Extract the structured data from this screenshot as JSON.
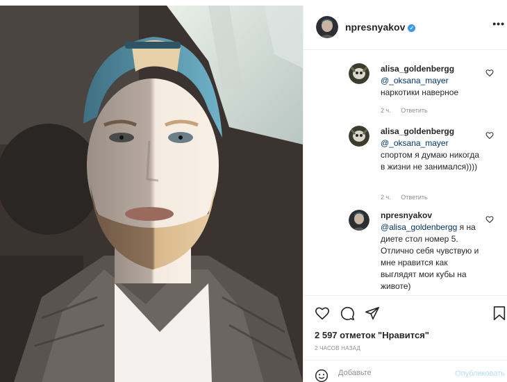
{
  "post": {
    "author": {
      "username": "npresnyakov",
      "verified": true,
      "more_label": "•••"
    },
    "photo": {
      "description_icon": "selfie-photo"
    },
    "comments": [
      {
        "username": "alisa_goldenbergg",
        "mention": "@_oksana_mayer",
        "text": "наркотики наверное",
        "time": "2 ч.",
        "reply_label": "Ответить"
      },
      {
        "username": "alisa_goldenbergg",
        "mention": "@_oksana_mayer",
        "text": "спортом я думаю никогда в жизни не занимался))))",
        "time": "2 ч.",
        "reply_label": "Ответить"
      },
      {
        "username": "npresnyakov",
        "mention": "@alisa_goldenbergg",
        "text": "я на диете стол номер 5. Отлично себя чувствую и мне нравится как выглядят мои кубы на животе)"
      }
    ],
    "actions": {
      "icons": [
        "heart-icon",
        "comment-icon",
        "share-icon",
        "bookmark-icon"
      ]
    },
    "likes_text": "2 597 отметок \"Нравится\"",
    "timestamp": "2 ЧАСОВ НАЗАД",
    "comment_box": {
      "placeholder": "Добавьте",
      "publish_label": "Опубликовать"
    },
    "colors": {
      "verified": "#3897f0",
      "mention": "#003569",
      "publish_disabled": "#b2dffc",
      "muted": "#8e8e8e"
    }
  }
}
